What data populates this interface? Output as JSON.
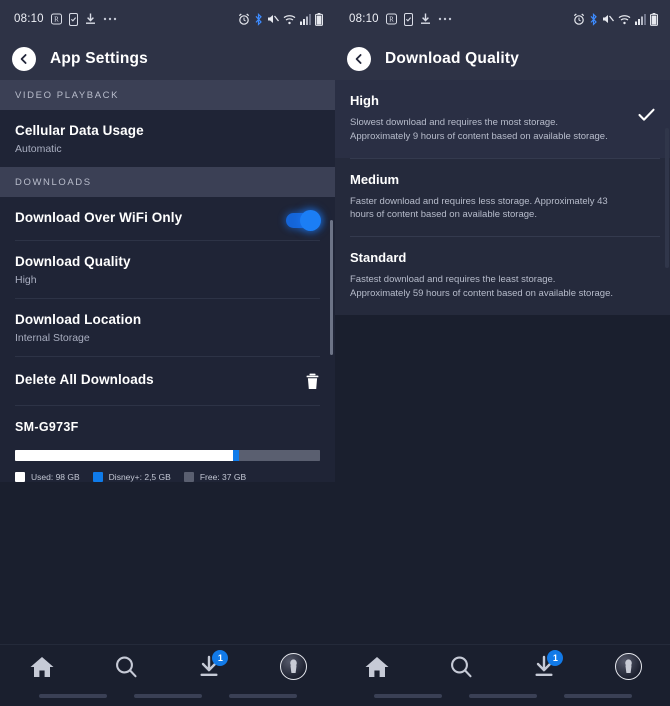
{
  "status_bar": {
    "time": "08:10",
    "left_icons": [
      "r-box-icon",
      "phone-check-icon",
      "download-icon",
      "more-ellipsis-icon"
    ],
    "right_icons": [
      "alarm-icon",
      "bluetooth-icon",
      "mute-icon",
      "wifi-icon",
      "signal-icon",
      "battery-icon"
    ]
  },
  "colors": {
    "accent_blue": "#127ae8",
    "toggle_on": "#1b7ef5",
    "header_bg": "#2e3346",
    "section_header_bg": "#3b4055",
    "list_bg": "#1f2436",
    "options_bg": "#252a3c",
    "app_bg": "#1a1f2e",
    "used_swatch": "#ffffff",
    "app_swatch": "#0f7bea",
    "free_swatch": "#5a5f70"
  },
  "left_screen": {
    "header": {
      "title": "App Settings",
      "back_icon": "chevron-left-icon"
    },
    "sections": [
      {
        "label": "VIDEO PLAYBACK",
        "rows": [
          {
            "title": "Cellular Data Usage",
            "subtitle": "Automatic",
            "control": "none"
          }
        ]
      },
      {
        "label": "DOWNLOADS",
        "rows": [
          {
            "title": "Download Over WiFi Only",
            "subtitle": "",
            "control": "toggle",
            "toggle_on": true
          },
          {
            "title": "Download Quality",
            "subtitle": "High",
            "control": "none"
          },
          {
            "title": "Download Location",
            "subtitle": "Internal Storage",
            "control": "none"
          },
          {
            "title": "Delete All Downloads",
            "subtitle": "",
            "control": "trash-icon"
          }
        ]
      }
    ],
    "storage": {
      "device_name": "SM-G973F",
      "legend": [
        {
          "label": "Used: 98 GB",
          "color": "#ffffff",
          "percent": 71.5
        },
        {
          "label": "Disney+: 2,5 GB",
          "color": "#0f7bea",
          "percent": 2.0
        },
        {
          "label": "Free: 37 GB",
          "color": "#5a5f70",
          "percent": 26.5
        }
      ]
    }
  },
  "right_screen": {
    "header": {
      "title": "Download Quality",
      "back_icon": "chevron-left-icon"
    },
    "options": [
      {
        "title": "High",
        "description": "Slowest download and requires the most storage. Approximately 9 hours of content based on available storage.",
        "selected": true
      },
      {
        "title": "Medium",
        "description": "Faster download and requires less storage. Approximately 43 hours of content based on available storage.",
        "selected": false
      },
      {
        "title": "Standard",
        "description": "Fastest download and requires the least storage. Approximately 59 hours of content based on available storage.",
        "selected": false
      }
    ]
  },
  "bottom_nav": {
    "items": [
      {
        "icon": "home-icon",
        "badge": ""
      },
      {
        "icon": "search-icon",
        "badge": ""
      },
      {
        "icon": "downloads-icon",
        "badge": "1"
      },
      {
        "icon": "profile-avatar-icon",
        "badge": ""
      }
    ]
  }
}
